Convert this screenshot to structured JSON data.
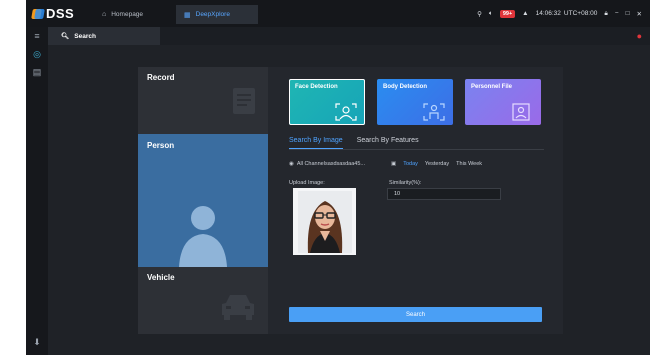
{
  "app": {
    "logo_text": "DSS"
  },
  "tabs": [
    {
      "label": "Homepage",
      "icon": "home-icon"
    },
    {
      "label": "DeepXplore",
      "icon": "grid-icon"
    }
  ],
  "status_bar": {
    "alarm_count": "99+",
    "time": "14:06:32",
    "timezone": "UTC+08:00"
  },
  "subbar": {
    "search_tab_label": "Search"
  },
  "categories": [
    {
      "label": "Record"
    },
    {
      "label": "Person"
    },
    {
      "label": "Vehicle"
    }
  ],
  "cards": [
    {
      "label": "Face Detection"
    },
    {
      "label": "Body Detection"
    },
    {
      "label": "Personnel File"
    }
  ],
  "sub_tabs": [
    {
      "label": "Search By Image"
    },
    {
      "label": "Search By Features"
    }
  ],
  "filters": {
    "channels": "All Channelsasdsasdaa45...",
    "dates": [
      "Today",
      "Yesterday",
      "This Week"
    ]
  },
  "upload": {
    "label": "Upload Image:"
  },
  "similarity": {
    "label": "Similarity(%):",
    "value": "10"
  },
  "search_button": {
    "label": "Search"
  },
  "colors": {
    "accent": "#4a9ff5",
    "selected_category": "#3a6da0",
    "alarm": "#e0353b"
  }
}
